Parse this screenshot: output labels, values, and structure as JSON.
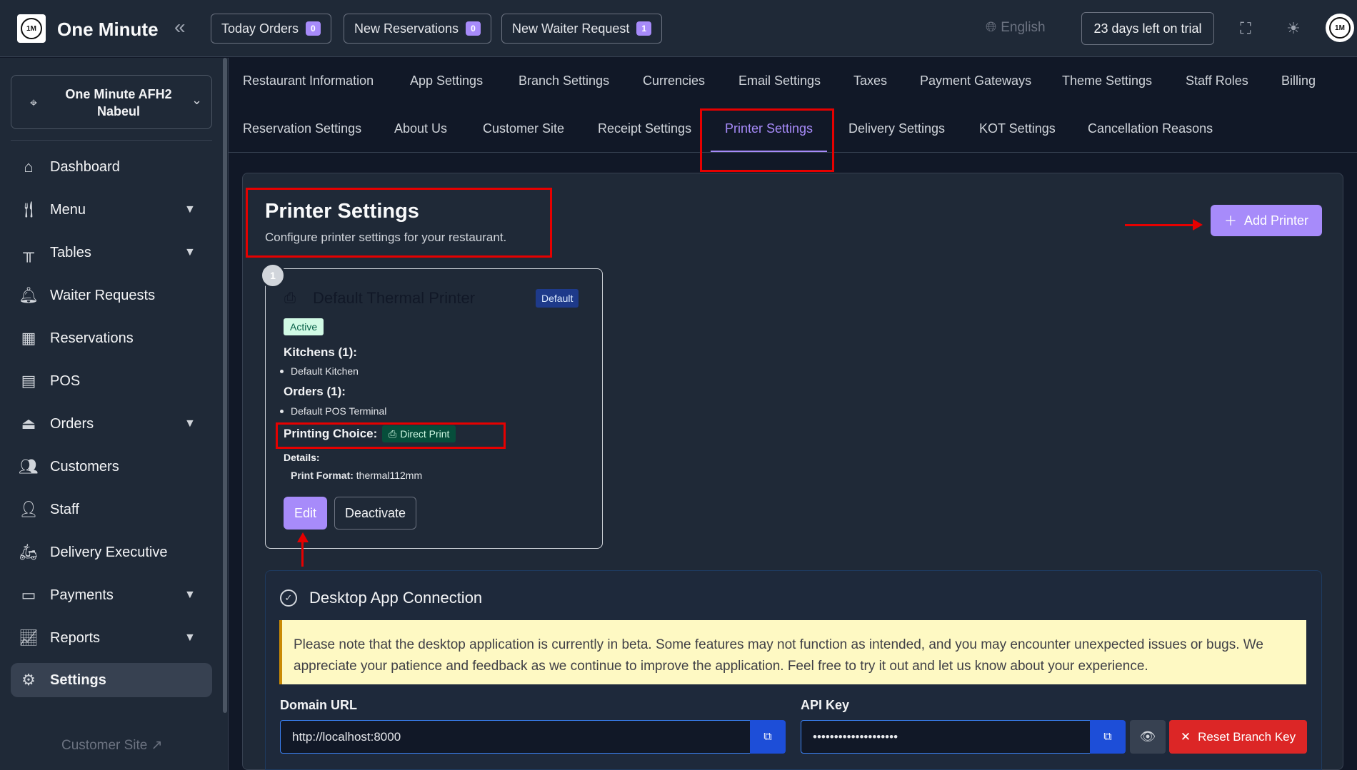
{
  "app": {
    "name": "One Minute",
    "logo_text": "1M"
  },
  "topbar": {
    "today_orders": {
      "label": "Today Orders",
      "count": "0"
    },
    "new_reservations": {
      "label": "New Reservations",
      "count": "0"
    },
    "new_waiter_request": {
      "label": "New Waiter Request",
      "count": "1"
    },
    "language": "English",
    "trial": "23 days left on trial"
  },
  "sidebar": {
    "branch": "One Minute AFH2 Nabeul",
    "items": [
      {
        "label": "Dashboard",
        "icon": "home-icon"
      },
      {
        "label": "Menu",
        "icon": "menu-icon"
      },
      {
        "label": "Tables",
        "icon": "table-icon"
      },
      {
        "label": "Waiter Requests",
        "icon": "bell-icon"
      },
      {
        "label": "Reservations",
        "icon": "calendar-icon"
      },
      {
        "label": "POS",
        "icon": "pos-icon"
      },
      {
        "label": "Orders",
        "icon": "cloche-icon"
      },
      {
        "label": "Customers",
        "icon": "users-icon"
      },
      {
        "label": "Staff",
        "icon": "staff-icon"
      },
      {
        "label": "Delivery Executive",
        "icon": "scooter-icon"
      },
      {
        "label": "Payments",
        "icon": "wallet-icon"
      },
      {
        "label": "Reports",
        "icon": "chart-icon"
      },
      {
        "label": "Settings",
        "icon": "gear-icon"
      }
    ],
    "customer_site": "Customer Site"
  },
  "tabs": {
    "row1": [
      "Restaurant Information",
      "App Settings",
      "Branch Settings",
      "Currencies",
      "Email Settings",
      "Taxes",
      "Payment Gateways",
      "Theme Settings",
      "Staff Roles",
      "Billing"
    ],
    "row2": [
      "Reservation Settings",
      "About Us",
      "Customer Site",
      "Receipt Settings",
      "Printer Settings",
      "Delivery Settings",
      "KOT Settings",
      "Cancellation Reasons"
    ],
    "active": "Printer Settings"
  },
  "page": {
    "title": "Printer Settings",
    "subtitle": "Configure printer settings for your restaurant.",
    "add_button": "Add Printer"
  },
  "printer": {
    "number": "1",
    "name": "Default Thermal Printer",
    "default_badge": "Default",
    "status": "Active",
    "kitchens_heading": "Kitchens (1):",
    "kitchen": "Default Kitchen",
    "orders_heading": "Orders (1):",
    "order": "Default POS Terminal",
    "printing_choice_label": "Printing Choice:",
    "printing_choice": "Direct Print",
    "details_label": "Details:",
    "print_format_label": "Print Format:",
    "print_format": "thermal112mm",
    "edit": "Edit",
    "deactivate": "Deactivate"
  },
  "desktop": {
    "title": "Desktop App Connection",
    "warning": "Please note that the desktop application is currently in beta. Some features may not function as intended, and you may encounter unexpected issues or bugs. We appreciate your patience and feedback as we continue to improve the application. Feel free to try it out and let us know about your experience.",
    "domain_label": "Domain URL",
    "domain_value": "http://localhost:8000",
    "api_label": "API Key",
    "api_value": "••••••••••••••••••••",
    "reset_button": "Reset Branch Key"
  },
  "colors": {
    "accent": "#a78bfa",
    "annotation": "#e60000",
    "danger": "#dc2626"
  }
}
